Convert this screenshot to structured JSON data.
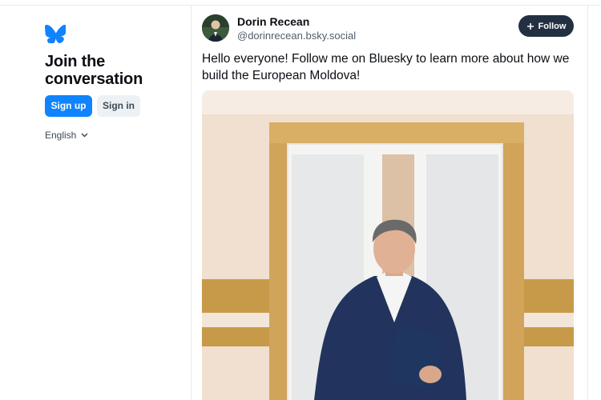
{
  "signup_panel": {
    "heading": "Join the conversation",
    "signup_label": "Sign up",
    "signin_label": "Sign in",
    "language": "English",
    "logo_icon": "butterfly-icon",
    "brand_color": "#1083fe"
  },
  "post": {
    "author_name": "Dorin Recean",
    "author_handle": "@dorinrecean.bsky.social",
    "follow_label": "Follow",
    "text": "Hello everyone! Follow me on Bluesky to learn more about how we build the European Moldova!",
    "avatar_icon": "avatar",
    "image_icon": "post-photo"
  }
}
